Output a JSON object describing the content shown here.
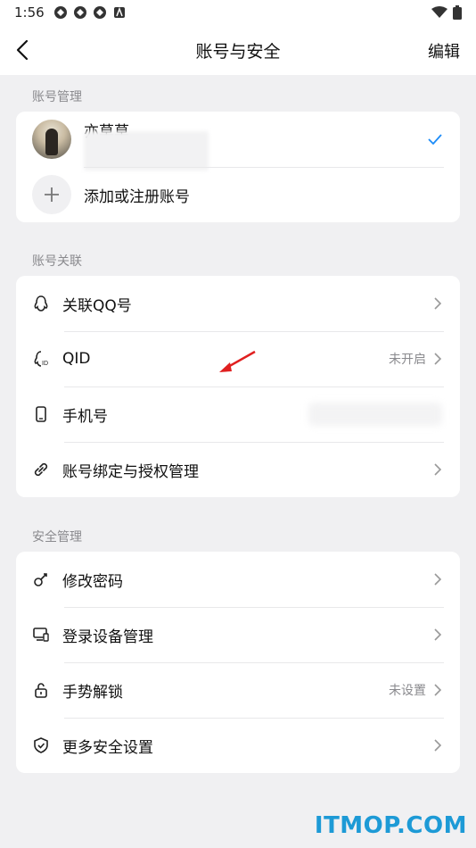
{
  "status_bar": {
    "time": "1:56"
  },
  "header": {
    "title": "账号与安全",
    "edit_label": "编辑"
  },
  "account_section": {
    "label": "账号管理",
    "current_account": {
      "name": "亦草草"
    },
    "add_account_label": "添加或注册账号"
  },
  "link_section": {
    "label": "账号关联",
    "items": [
      {
        "label": "关联QQ号",
        "status": ""
      },
      {
        "label": "QID",
        "status": "未开启"
      },
      {
        "label": "手机号",
        "status": ""
      },
      {
        "label": "账号绑定与授权管理",
        "status": ""
      }
    ]
  },
  "security_section": {
    "label": "安全管理",
    "items": [
      {
        "label": "修改密码",
        "status": ""
      },
      {
        "label": "登录设备管理",
        "status": ""
      },
      {
        "label": "手势解锁",
        "status": "未设置"
      },
      {
        "label": "更多安全设置",
        "status": ""
      }
    ]
  },
  "watermark": "ITMOP.COM",
  "colors": {
    "accent": "#1d8cf8",
    "background": "#f0f0f2",
    "watermark": "#1d9ad6",
    "annotation_arrow": "#e02020"
  }
}
